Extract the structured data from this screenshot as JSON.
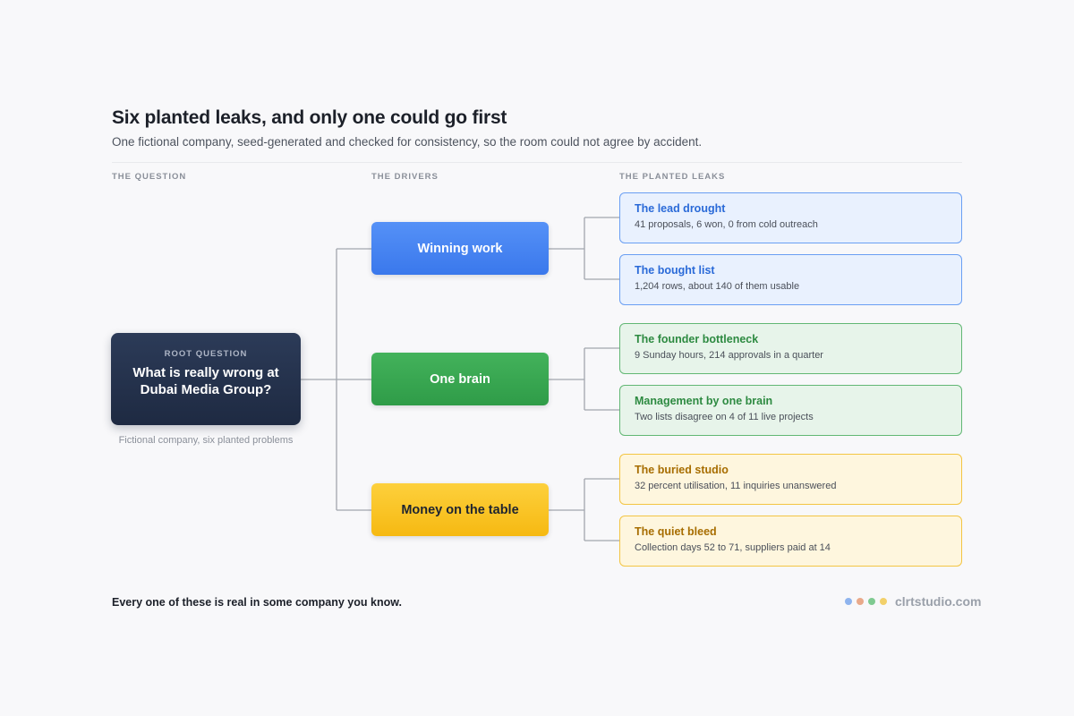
{
  "header": {
    "title": "Six planted leaks, and only one could go first",
    "subtitle": "One fictional company, seed-generated and checked for consistency, so the room could not agree by accident."
  },
  "columns": {
    "question": "THE QUESTION",
    "drivers": "THE DRIVERS",
    "leaks": "THE PLANTED LEAKS"
  },
  "root": {
    "label": "ROOT QUESTION",
    "text": "What is really wrong at Dubai Media Group?",
    "caption": "Fictional company, six planted problems"
  },
  "drivers": [
    {
      "label": "Winning work",
      "color": "#3f7ef0"
    },
    {
      "label": "One brain",
      "color": "#34a24d"
    },
    {
      "label": "Money on the table",
      "color": "#f8c11f"
    }
  ],
  "leaks": [
    {
      "title": "The lead drought",
      "desc": "41 proposals, 6 won, 0 from cold outreach"
    },
    {
      "title": "The bought list",
      "desc": "1,204 rows, about 140 of them usable"
    },
    {
      "title": "The founder bottleneck",
      "desc": "9 Sunday hours, 214 approvals in a quarter"
    },
    {
      "title": "Management by one brain",
      "desc": "Two lists disagree on 4 of 11 live projects"
    },
    {
      "title": "The buried studio",
      "desc": "32 percent utilisation, 11 inquiries unanswered"
    },
    {
      "title": "The quiet bleed",
      "desc": "Collection days 52 to 71, suppliers paid at 14"
    }
  ],
  "footer": {
    "text": "Every one of these is real in some company you know.",
    "brand": "clrtstudio.com",
    "brand_dots": [
      "#8fb4ee",
      "#e9a98a",
      "#7fca91",
      "#f2d06a"
    ]
  }
}
